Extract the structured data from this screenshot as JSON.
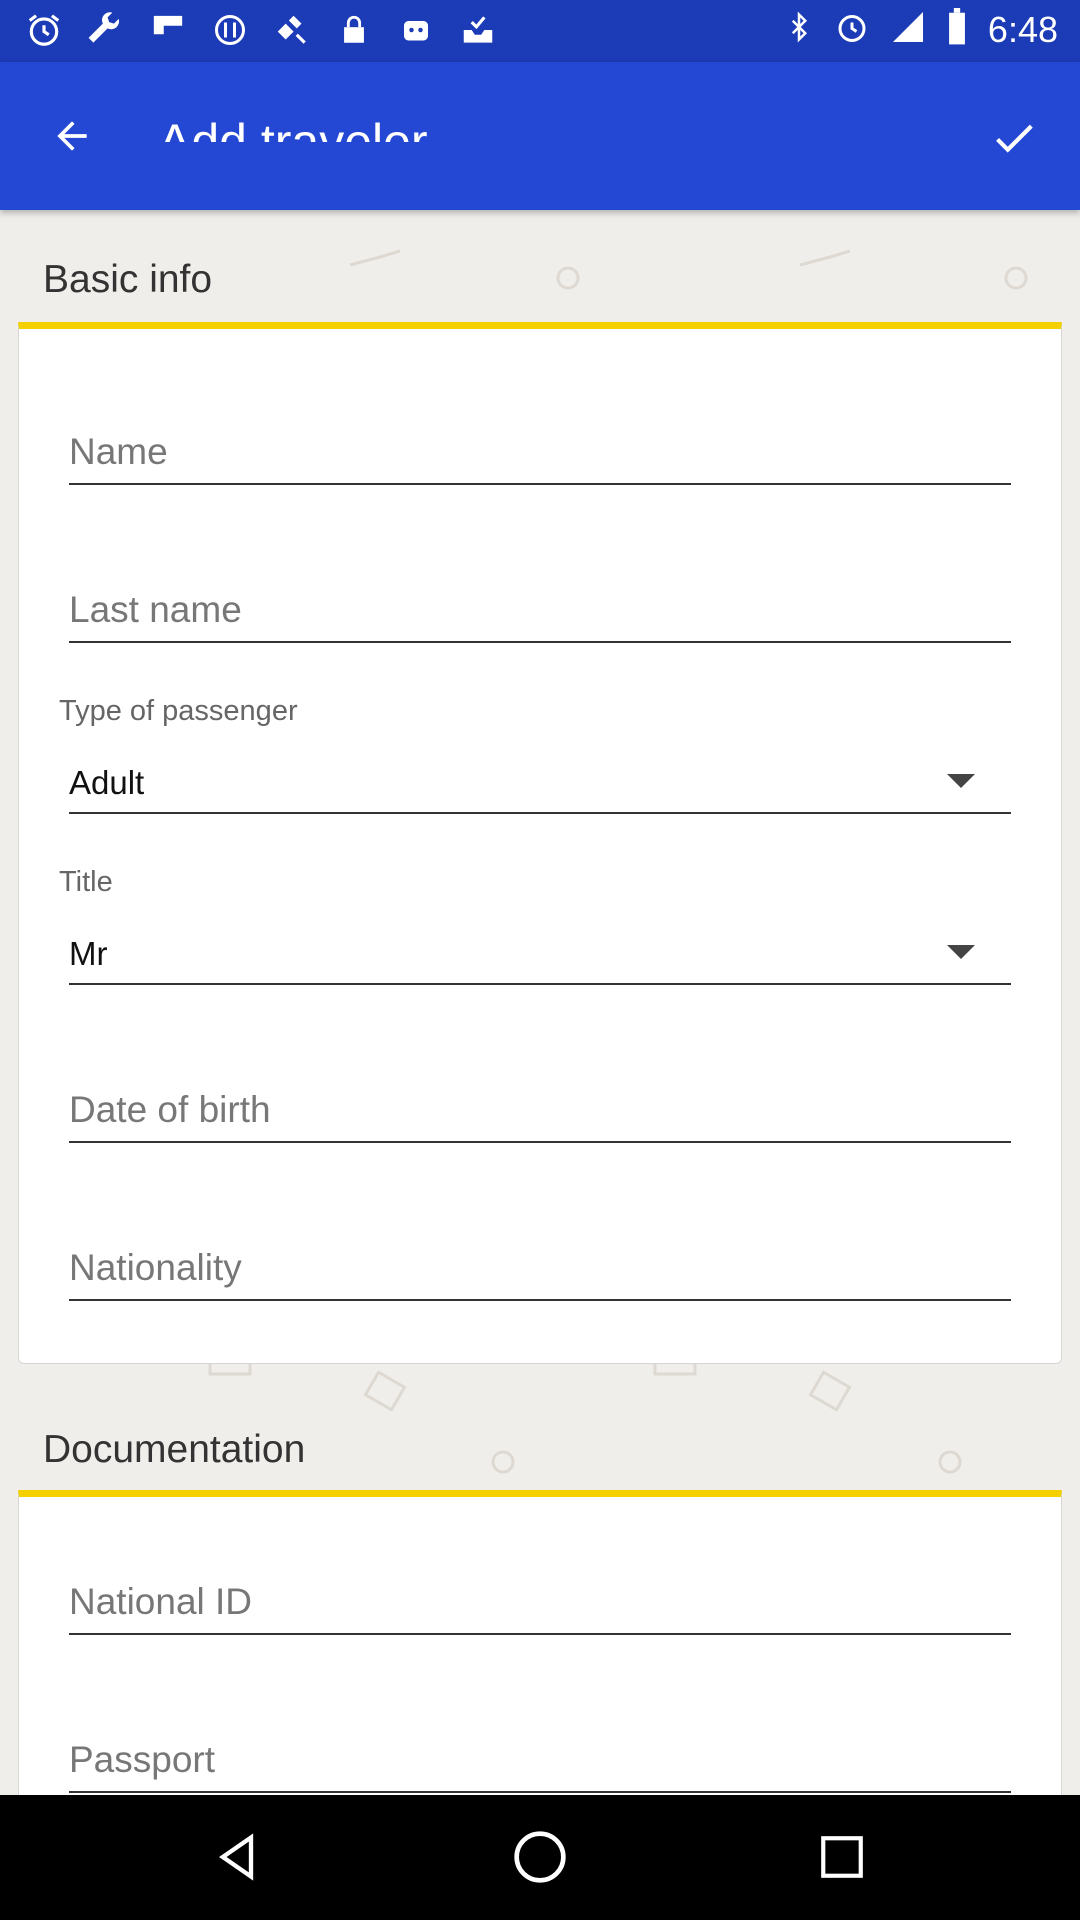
{
  "status_bar": {
    "time": "6:48",
    "left_icons": [
      "alarm-icon",
      "wrench-icon",
      "flipboard-icon",
      "settings-icon",
      "satellite-icon",
      "lock-icon",
      "robot-icon",
      "inbox-check-icon"
    ],
    "right_icons": [
      "bluetooth-icon",
      "alarm-icon",
      "signal-icon",
      "battery-icon"
    ]
  },
  "app_bar": {
    "title": "Add traveler",
    "back_icon": "arrow-back-icon",
    "confirm_icon": "check-icon"
  },
  "basic_info": {
    "section_title": "Basic info",
    "name_placeholder": "Name",
    "last_name_placeholder": "Last name",
    "passenger_type_label": "Type of passenger",
    "passenger_type_value": "Adult",
    "title_label": "Title",
    "title_value": "Mr",
    "dob_placeholder": "Date of birth",
    "nationality_placeholder": "Nationality"
  },
  "documentation": {
    "section_title": "Documentation",
    "national_id_placeholder": "National ID",
    "passport_placeholder": "Passport"
  },
  "colors": {
    "status_bar": "#1c3bb6",
    "app_bar": "#2448d4",
    "accent_yellow": "#f5d000",
    "background": "#f0eeea"
  }
}
